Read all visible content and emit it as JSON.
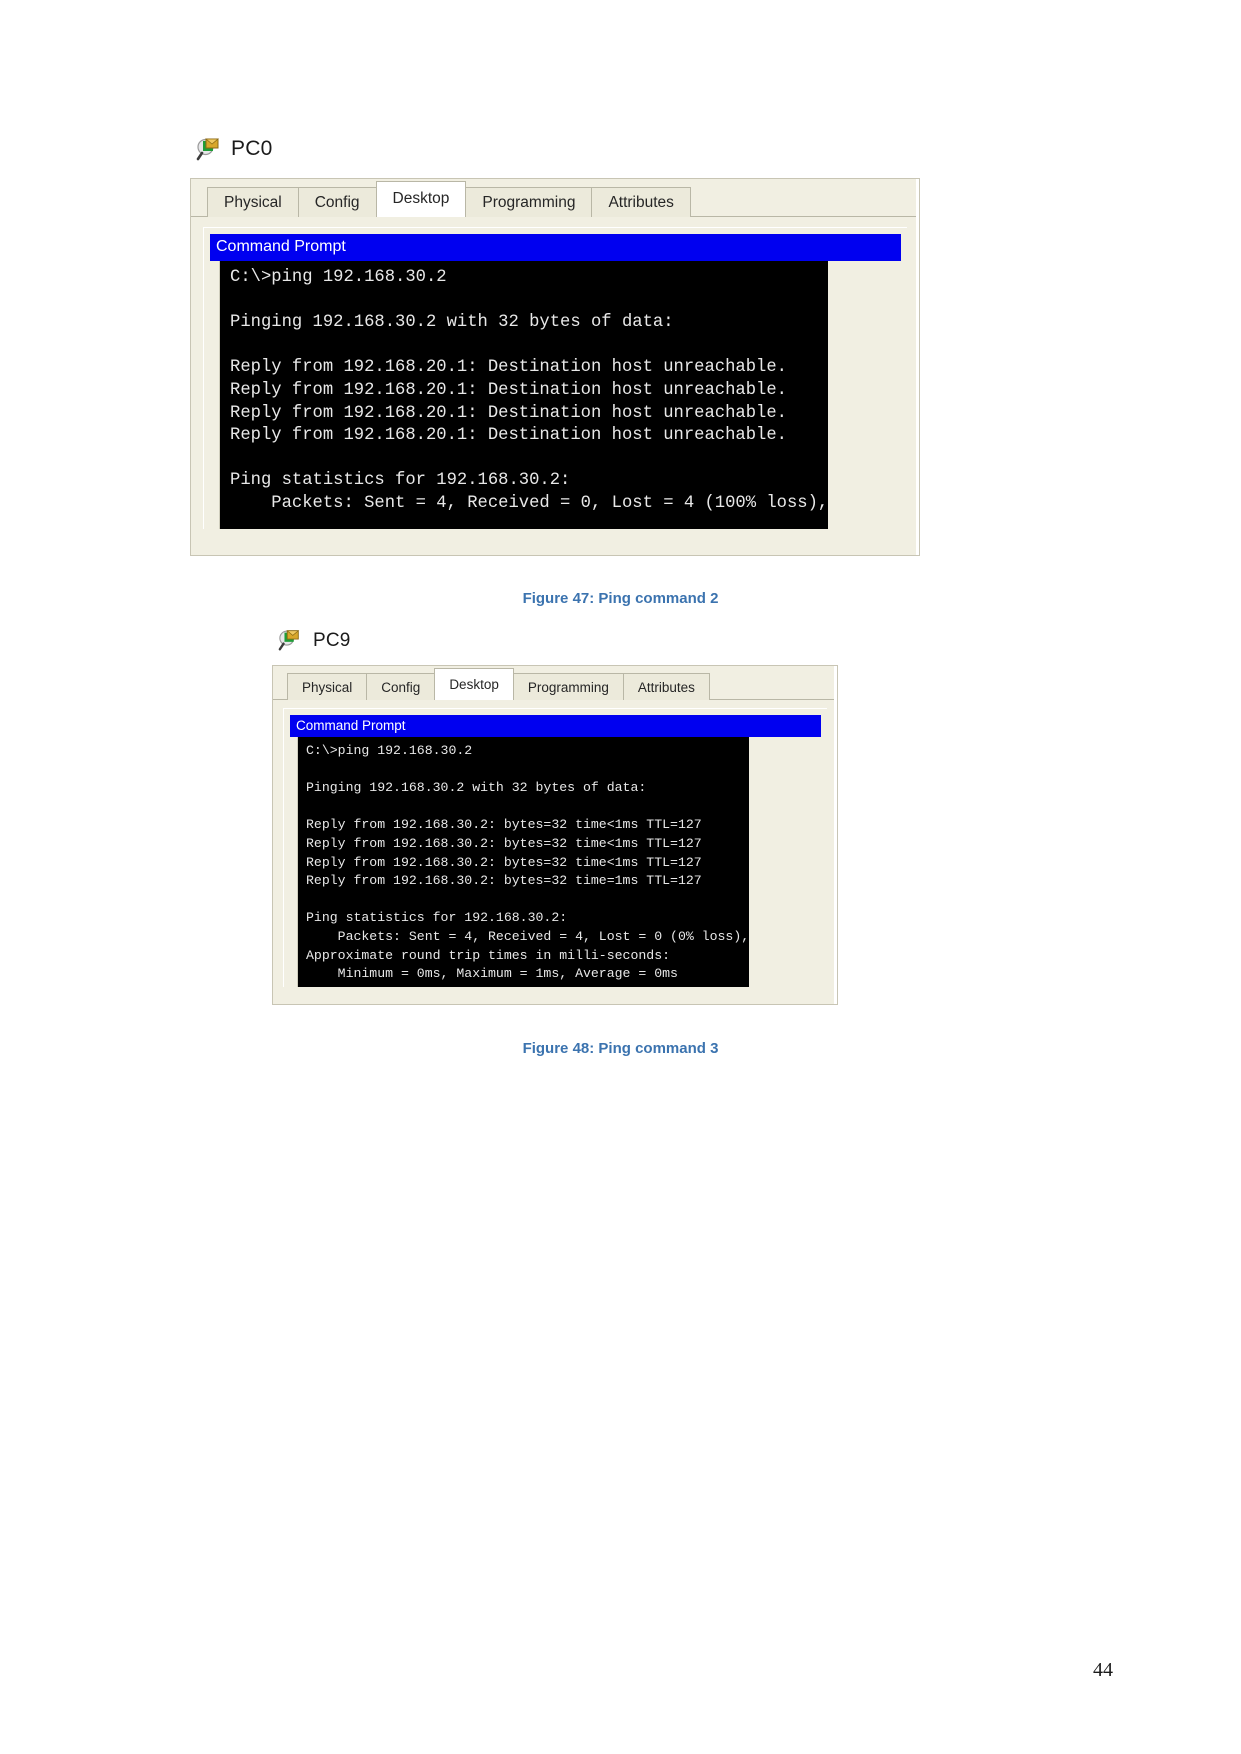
{
  "page": {
    "number": "44"
  },
  "figure_1": {
    "device": {
      "name": "PC0",
      "icon": "pc-magnifier-icon"
    },
    "tabs": [
      {
        "label": "Physical",
        "active": false
      },
      {
        "label": "Config",
        "active": false
      },
      {
        "label": "Desktop",
        "active": true
      },
      {
        "label": "Programming",
        "active": false
      },
      {
        "label": "Attributes",
        "active": false
      }
    ],
    "panel_title": "Command Prompt",
    "console_lines": [
      "C:\\>ping 192.168.30.2",
      "",
      "Pinging 192.168.30.2 with 32 bytes of data:",
      "",
      "Reply from 192.168.20.1: Destination host unreachable.",
      "Reply from 192.168.20.1: Destination host unreachable.",
      "Reply from 192.168.20.1: Destination host unreachable.",
      "Reply from 192.168.20.1: Destination host unreachable.",
      "",
      "Ping statistics for 192.168.30.2:",
      "    Packets: Sent = 4, Received = 0, Lost = 4 (100% loss),"
    ],
    "caption": "Figure 47: Ping command 2"
  },
  "figure_2": {
    "device": {
      "name": "PC9",
      "icon": "pc-magnifier-icon"
    },
    "tabs": [
      {
        "label": "Physical",
        "active": false
      },
      {
        "label": "Config",
        "active": false
      },
      {
        "label": "Desktop",
        "active": true
      },
      {
        "label": "Programming",
        "active": false
      },
      {
        "label": "Attributes",
        "active": false
      }
    ],
    "panel_title": "Command Prompt",
    "console_lines": [
      "C:\\>ping 192.168.30.2",
      "",
      "Pinging 192.168.30.2 with 32 bytes of data:",
      "",
      "Reply from 192.168.30.2: bytes=32 time<1ms TTL=127",
      "Reply from 192.168.30.2: bytes=32 time<1ms TTL=127",
      "Reply from 192.168.30.2: bytes=32 time<1ms TTL=127",
      "Reply from 192.168.30.2: bytes=32 time=1ms TTL=127",
      "",
      "Ping statistics for 192.168.30.2:",
      "    Packets: Sent = 4, Received = 4, Lost = 0 (0% loss),",
      "Approximate round trip times in milli-seconds:",
      "    Minimum = 0ms, Maximum = 1ms, Average = 0ms"
    ],
    "caption": "Figure 48: Ping command 3"
  },
  "colors": {
    "titlebar_blue": "#0000f0",
    "caption_blue": "#3b73af",
    "console_bg": "#000000",
    "window_bg": "#f1efe2"
  }
}
